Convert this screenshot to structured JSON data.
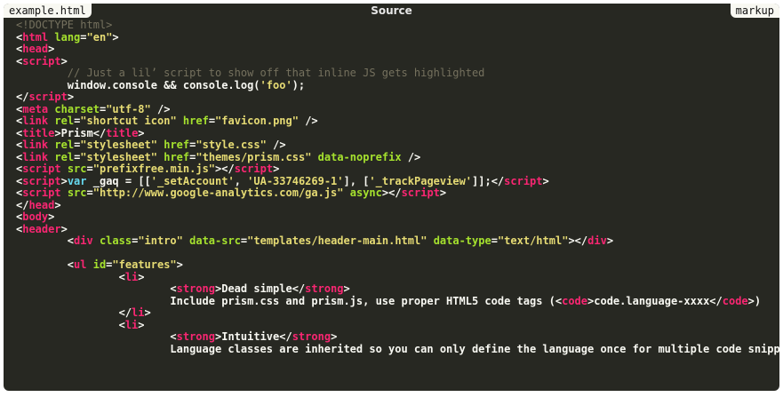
{
  "window": {
    "filename": "example.html",
    "title": "Source",
    "language": "markup"
  },
  "colors": {
    "background": "#272822",
    "tag": "#f92672",
    "attr": "#a6e22e",
    "string": "#e6db74",
    "comment": "#75715e",
    "keyword": "#66d9ef",
    "text": "#f8f8f2"
  },
  "code_lines": [
    [
      [
        "doctype",
        "<!DOCTYPE html>"
      ]
    ],
    [
      [
        "punct",
        "<"
      ],
      [
        "tag",
        "html"
      ],
      [
        "plain",
        " "
      ],
      [
        "attr",
        "lang"
      ],
      [
        "punct",
        "="
      ],
      [
        "str",
        "\"en\""
      ],
      [
        "punct",
        ">"
      ]
    ],
    [
      [
        "punct",
        "<"
      ],
      [
        "tag",
        "head"
      ],
      [
        "punct",
        ">"
      ]
    ],
    [
      [
        "punct",
        "<"
      ],
      [
        "tag",
        "script"
      ],
      [
        "punct",
        ">"
      ]
    ],
    [
      [
        "plain",
        "        "
      ],
      [
        "comment",
        "// Just a lil’ script to show off that inline JS gets highlighted"
      ]
    ],
    [
      [
        "plain",
        "        window.console && console.log("
      ],
      [
        "str",
        "'foo'"
      ],
      [
        "plain",
        ");"
      ]
    ],
    [
      [
        "punct",
        "</"
      ],
      [
        "tag",
        "script"
      ],
      [
        "punct",
        ">"
      ]
    ],
    [
      [
        "punct",
        "<"
      ],
      [
        "tag",
        "meta"
      ],
      [
        "plain",
        " "
      ],
      [
        "attr",
        "charset"
      ],
      [
        "punct",
        "="
      ],
      [
        "str",
        "\"utf-8\""
      ],
      [
        "plain",
        " "
      ],
      [
        "punct",
        "/>"
      ]
    ],
    [
      [
        "punct",
        "<"
      ],
      [
        "tag",
        "link"
      ],
      [
        "plain",
        " "
      ],
      [
        "attr",
        "rel"
      ],
      [
        "punct",
        "="
      ],
      [
        "str",
        "\"shortcut icon\""
      ],
      [
        "plain",
        " "
      ],
      [
        "attr",
        "href"
      ],
      [
        "punct",
        "="
      ],
      [
        "str",
        "\"favicon.png\""
      ],
      [
        "plain",
        " "
      ],
      [
        "punct",
        "/>"
      ]
    ],
    [
      [
        "punct",
        "<"
      ],
      [
        "tag",
        "title"
      ],
      [
        "punct",
        ">"
      ],
      [
        "plain",
        "Prism"
      ],
      [
        "punct",
        "</"
      ],
      [
        "tag",
        "title"
      ],
      [
        "punct",
        ">"
      ]
    ],
    [
      [
        "punct",
        "<"
      ],
      [
        "tag",
        "link"
      ],
      [
        "plain",
        " "
      ],
      [
        "attr",
        "rel"
      ],
      [
        "punct",
        "="
      ],
      [
        "str",
        "\"stylesheet\""
      ],
      [
        "plain",
        " "
      ],
      [
        "attr",
        "href"
      ],
      [
        "punct",
        "="
      ],
      [
        "str",
        "\"style.css\""
      ],
      [
        "plain",
        " "
      ],
      [
        "punct",
        "/>"
      ]
    ],
    [
      [
        "punct",
        "<"
      ],
      [
        "tag",
        "link"
      ],
      [
        "plain",
        " "
      ],
      [
        "attr",
        "rel"
      ],
      [
        "punct",
        "="
      ],
      [
        "str",
        "\"stylesheet\""
      ],
      [
        "plain",
        " "
      ],
      [
        "attr",
        "href"
      ],
      [
        "punct",
        "="
      ],
      [
        "str",
        "\"themes/prism.css\""
      ],
      [
        "plain",
        " "
      ],
      [
        "attr",
        "data-noprefix"
      ],
      [
        "plain",
        " "
      ],
      [
        "punct",
        "/>"
      ]
    ],
    [
      [
        "punct",
        "<"
      ],
      [
        "tag",
        "script"
      ],
      [
        "plain",
        " "
      ],
      [
        "attr",
        "src"
      ],
      [
        "punct",
        "="
      ],
      [
        "str",
        "\"prefixfree.min.js\""
      ],
      [
        "punct",
        "></"
      ],
      [
        "tag",
        "script"
      ],
      [
        "punct",
        ">"
      ]
    ],
    [
      [
        "punct",
        "<"
      ],
      [
        "tag",
        "script"
      ],
      [
        "punct",
        ">"
      ],
      [
        "key",
        "var"
      ],
      [
        "plain",
        " _gaq = [["
      ],
      [
        "str",
        "'_setAccount'"
      ],
      [
        "plain",
        ", "
      ],
      [
        "str",
        "'UA-33746269-1'"
      ],
      [
        "plain",
        "], ["
      ],
      [
        "str",
        "'_trackPageview'"
      ],
      [
        "plain",
        "]];"
      ],
      [
        "punct",
        "</"
      ],
      [
        "tag",
        "script"
      ],
      [
        "punct",
        ">"
      ]
    ],
    [
      [
        "punct",
        "<"
      ],
      [
        "tag",
        "script"
      ],
      [
        "plain",
        " "
      ],
      [
        "attr",
        "src"
      ],
      [
        "punct",
        "="
      ],
      [
        "str",
        "\"http://www.google-analytics.com/ga.js\""
      ],
      [
        "plain",
        " "
      ],
      [
        "attr",
        "async"
      ],
      [
        "punct",
        "></"
      ],
      [
        "tag",
        "script"
      ],
      [
        "punct",
        ">"
      ]
    ],
    [
      [
        "punct",
        "</"
      ],
      [
        "tag",
        "head"
      ],
      [
        "punct",
        ">"
      ]
    ],
    [
      [
        "punct",
        "<"
      ],
      [
        "tag",
        "body"
      ],
      [
        "punct",
        ">"
      ]
    ],
    [
      [
        "punct",
        "<"
      ],
      [
        "tag",
        "header"
      ],
      [
        "punct",
        ">"
      ]
    ],
    [
      [
        "plain",
        "        "
      ],
      [
        "punct",
        "<"
      ],
      [
        "tag",
        "div"
      ],
      [
        "plain",
        " "
      ],
      [
        "attr",
        "class"
      ],
      [
        "punct",
        "="
      ],
      [
        "str",
        "\"intro\""
      ],
      [
        "plain",
        " "
      ],
      [
        "attr",
        "data-src"
      ],
      [
        "punct",
        "="
      ],
      [
        "str",
        "\"templates/header-main.html\""
      ],
      [
        "plain",
        " "
      ],
      [
        "attr",
        "data-type"
      ],
      [
        "punct",
        "="
      ],
      [
        "str",
        "\"text/html\""
      ],
      [
        "punct",
        "></"
      ],
      [
        "tag",
        "div"
      ],
      [
        "punct",
        ">"
      ]
    ],
    [
      [
        "plain",
        " "
      ]
    ],
    [
      [
        "plain",
        "        "
      ],
      [
        "punct",
        "<"
      ],
      [
        "tag",
        "ul"
      ],
      [
        "plain",
        " "
      ],
      [
        "attr",
        "id"
      ],
      [
        "punct",
        "="
      ],
      [
        "str",
        "\"features\""
      ],
      [
        "punct",
        ">"
      ]
    ],
    [
      [
        "plain",
        "                "
      ],
      [
        "punct",
        "<"
      ],
      [
        "tag",
        "li"
      ],
      [
        "punct",
        ">"
      ]
    ],
    [
      [
        "plain",
        "                        "
      ],
      [
        "punct",
        "<"
      ],
      [
        "tag",
        "strong"
      ],
      [
        "punct",
        ">"
      ],
      [
        "plain",
        "Dead simple"
      ],
      [
        "punct",
        "</"
      ],
      [
        "tag",
        "strong"
      ],
      [
        "punct",
        ">"
      ]
    ],
    [
      [
        "plain",
        "                        Include prism.css and prism.js, use proper HTML5 code tags ("
      ],
      [
        "punct",
        "<"
      ],
      [
        "tag",
        "code"
      ],
      [
        "punct",
        ">"
      ],
      [
        "plain",
        "code.language-xxxx"
      ],
      [
        "punct",
        "</"
      ],
      [
        "tag",
        "code"
      ],
      [
        "punct",
        ">"
      ],
      [
        "plain",
        ")"
      ]
    ],
    [
      [
        "plain",
        "                "
      ],
      [
        "punct",
        "</"
      ],
      [
        "tag",
        "li"
      ],
      [
        "punct",
        ">"
      ]
    ],
    [
      [
        "plain",
        "                "
      ],
      [
        "punct",
        "<"
      ],
      [
        "tag",
        "li"
      ],
      [
        "punct",
        ">"
      ]
    ],
    [
      [
        "plain",
        "                        "
      ],
      [
        "punct",
        "<"
      ],
      [
        "tag",
        "strong"
      ],
      [
        "punct",
        ">"
      ],
      [
        "plain",
        "Intuitive"
      ],
      [
        "punct",
        "</"
      ],
      [
        "tag",
        "strong"
      ],
      [
        "punct",
        ">"
      ]
    ],
    [
      [
        "plain",
        "                        Language classes are inherited so you can only define the language once for multiple code snippets."
      ]
    ]
  ]
}
